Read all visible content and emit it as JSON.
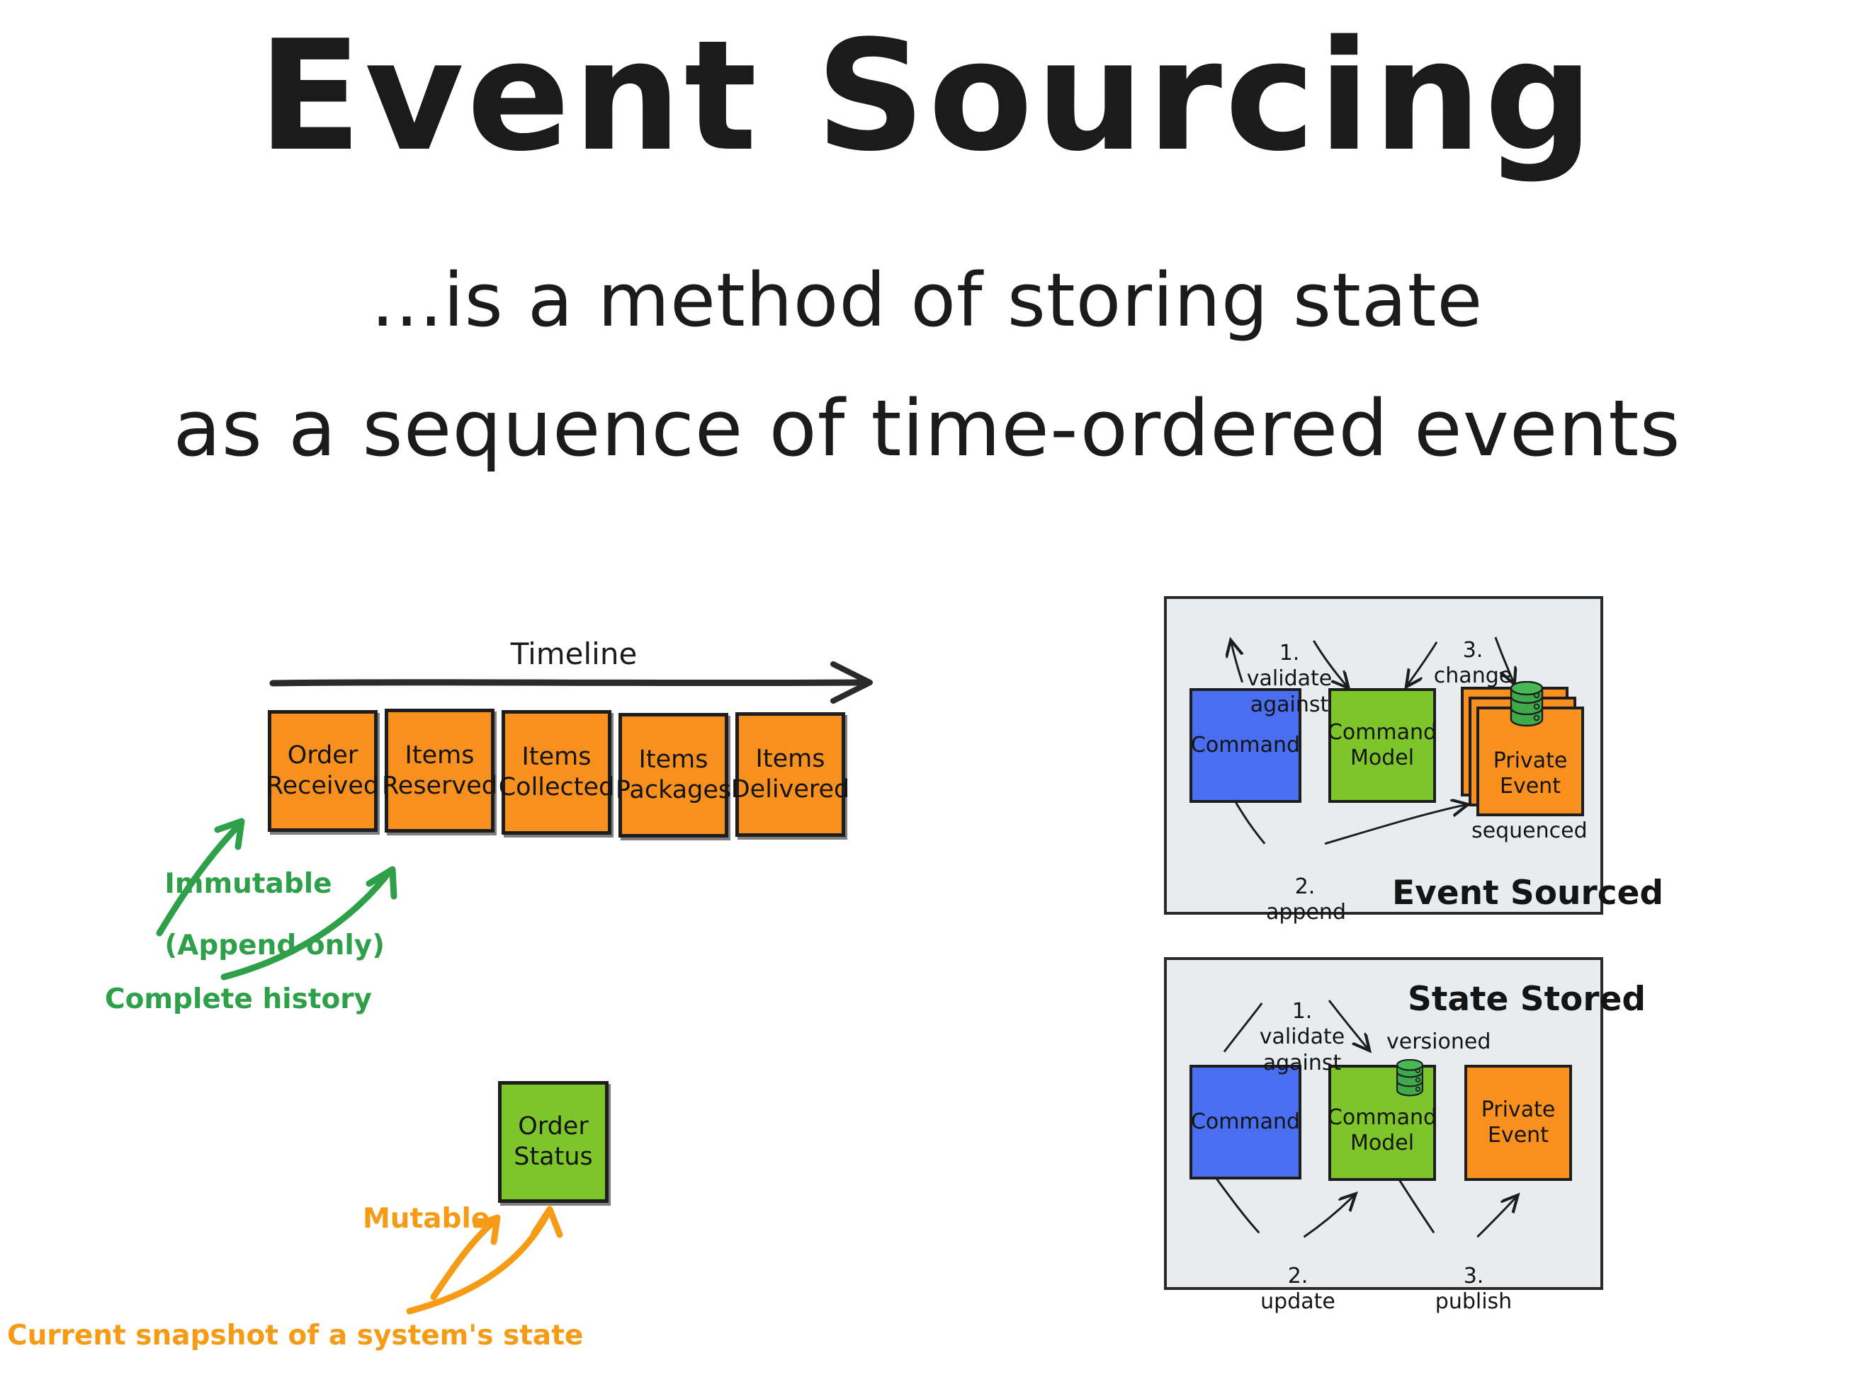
{
  "header": {
    "title": "Event Sourcing",
    "subtitle_line1": "...is a method of storing state",
    "subtitle_line2": "as a sequence of time-ordered events"
  },
  "colors": {
    "event_orange": "#F7901E",
    "state_green": "#7DC52A",
    "command_blue": "#4A6EF0",
    "panel_background": "#E8ECEE",
    "annotation_green": "#2EA04A",
    "annotation_orange": "#F59B16",
    "ink_black": "#1b1b1b",
    "database_green": "#3FA94C"
  },
  "timeline": {
    "label": "Timeline",
    "arrow_icon": "arrow-right-icon",
    "events": [
      {
        "line1": "Order",
        "line2": "Received"
      },
      {
        "line1": "Items",
        "line2": "Reserved"
      },
      {
        "line1": "Items",
        "line2": "Collected"
      },
      {
        "line1": "Items",
        "line2": "Packages"
      },
      {
        "line1": "Items",
        "line2": "Delivered"
      }
    ],
    "annotations": [
      {
        "name": "immutable",
        "line1": "Immutable",
        "line2": "(Append only)"
      },
      {
        "name": "complete-history",
        "line1": "Complete history",
        "line2": ""
      }
    ]
  },
  "state_snapshot": {
    "box": {
      "line1": "Order",
      "line2": "Status"
    },
    "annotations": [
      {
        "name": "mutable",
        "text": "Mutable"
      },
      {
        "name": "current-snapshot",
        "text": "Current snapshot of a system's state"
      }
    ]
  },
  "panels": [
    {
      "name": "event-sourced",
      "title": "Event Sourced",
      "nodes": [
        {
          "name": "command",
          "label": "Command",
          "color": "blue"
        },
        {
          "name": "command-model",
          "label": "Command\nModel",
          "color": "green"
        },
        {
          "name": "private-event",
          "label": "Private\nEvent",
          "color": "orange",
          "stacked": true,
          "db_icon": true
        }
      ],
      "steps": [
        {
          "num": "1.",
          "text": "validate\nagainst"
        },
        {
          "num": "2.",
          "text": "append"
        },
        {
          "num": "3.",
          "text": "change"
        }
      ],
      "notes": [
        {
          "name": "sequenced",
          "text": "sequenced"
        }
      ]
    },
    {
      "name": "state-stored",
      "title": "State Stored",
      "nodes": [
        {
          "name": "command",
          "label": "Command",
          "color": "blue"
        },
        {
          "name": "command-model",
          "label": "Command\nModel",
          "color": "green",
          "db_icon": true
        },
        {
          "name": "private-event",
          "label": "Private\nEvent",
          "color": "orange"
        }
      ],
      "steps": [
        {
          "num": "1.",
          "text": "validate\nagainst"
        },
        {
          "num": "2.",
          "text": "update"
        },
        {
          "num": "3.",
          "text": "publish"
        }
      ],
      "notes": [
        {
          "name": "versioned",
          "text": "versioned"
        }
      ]
    }
  ]
}
